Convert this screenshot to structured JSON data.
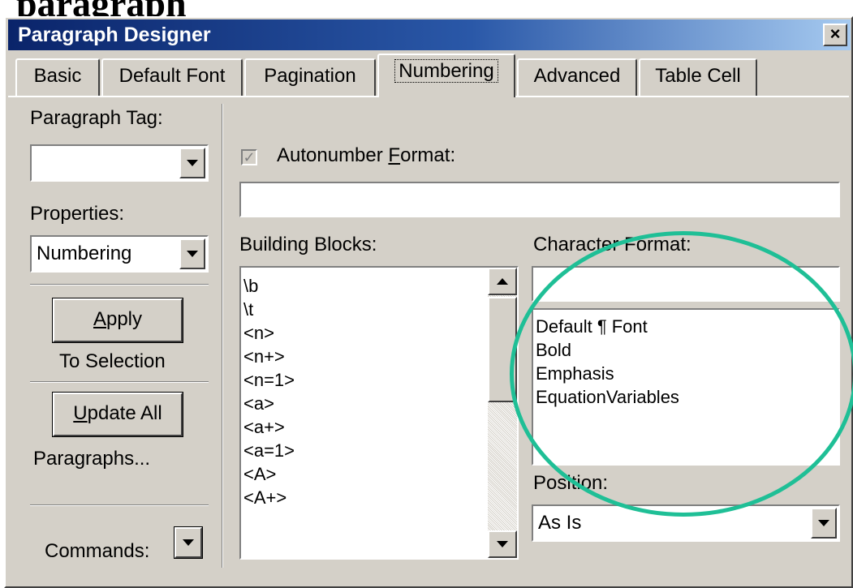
{
  "page_heading_fragment": "paragraph",
  "window": {
    "title": "Paragraph Designer",
    "close_label": "×"
  },
  "tabs": [
    {
      "label": "Basic"
    },
    {
      "label": "Default Font"
    },
    {
      "label": "Pagination"
    },
    {
      "label": "Numbering",
      "active": true
    },
    {
      "label": "Advanced"
    },
    {
      "label": "Table Cell"
    }
  ],
  "left_panel": {
    "paragraph_tag_label": "Paragraph Tag:",
    "paragraph_tag_value": "",
    "properties_label": "Properties:",
    "properties_value": "Numbering",
    "apply_button": {
      "pre": "",
      "mnemonic": "A",
      "post": "pply"
    },
    "apply_subtitle": "To Selection",
    "update_all_button": {
      "pre": "",
      "mnemonic": "U",
      "post": "pdate All"
    },
    "paragraphs_label": "Paragraphs...",
    "commands_label": "Commands:"
  },
  "numbering": {
    "autonumber_checked": true,
    "autonumber_label_pre": "Autonumber ",
    "autonumber_label_mnemonic": "F",
    "autonumber_label_post": "ormat:",
    "autonumber_value": "",
    "building_blocks_label": "Building Blocks:",
    "building_blocks": [
      "\\b",
      "\\t",
      "<n>",
      "<n+>",
      "<n=1>",
      "<a>",
      "<a+>",
      "<a=1>",
      "<A>",
      "<A+>"
    ],
    "character_format_label": "Character Format:",
    "character_format_value": "",
    "character_formats": [
      "Default ¶ Font",
      "Bold",
      "Emphasis",
      "EquationVariables"
    ],
    "position_label": "Position:",
    "position_value": "As Is"
  },
  "colors": {
    "titlebar_start": "#0a246a",
    "titlebar_end": "#a6caf0",
    "annotation_circle": "#1fbf96",
    "dialog_face": "#d4d0c8"
  }
}
